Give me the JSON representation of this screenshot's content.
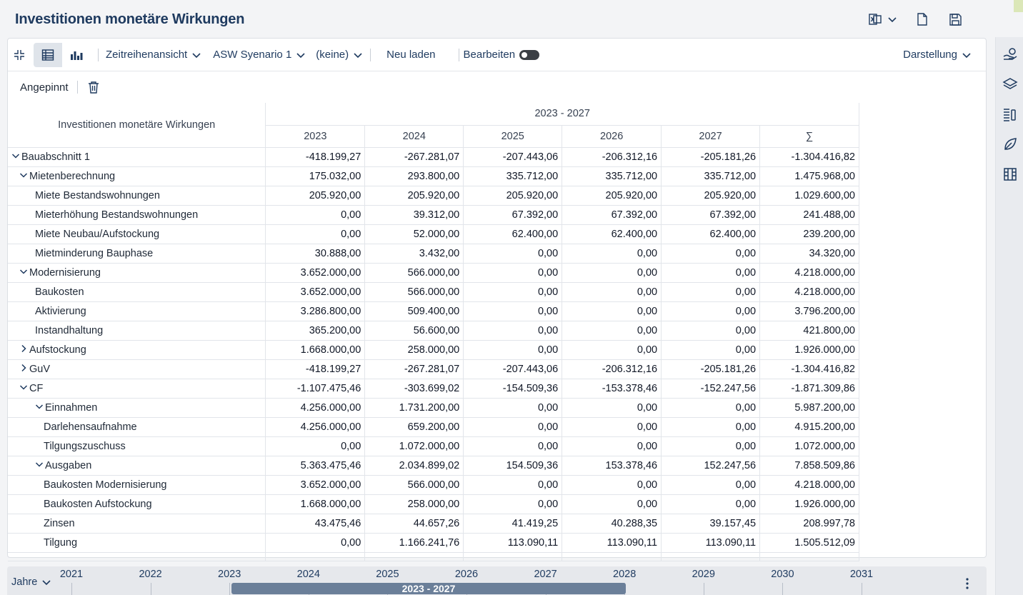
{
  "page": {
    "title": "Investitionen monetäre Wirkungen"
  },
  "toolbar": {
    "view_dropdown": "Zeitreihenansicht",
    "scenario_dropdown": "ASW Syenario 1",
    "filter_dropdown": "(keine)",
    "reload_label": "Neu laden",
    "edit_label": "Bearbeiten",
    "edit_enabled": false,
    "display_dropdown": "Darstellung"
  },
  "subbar": {
    "pinned_label": "Angepinnt"
  },
  "icons": {
    "collapse": "collapse-arrows-icon",
    "table_view": "table-icon",
    "chart_view": "bar-chart-icon",
    "excel_export": "excel-icon",
    "document": "document-icon",
    "save": "save-icon",
    "trash": "trash-icon",
    "rail": [
      "hand-coin-icon",
      "layers-icon",
      "list-bars-icon",
      "leaf-icon",
      "book-icon"
    ]
  },
  "grid": {
    "corner_header": "Investitionen monetäre Wirkungen",
    "period_header": "2023 - 2027",
    "columns": [
      "2023",
      "2024",
      "2025",
      "2026",
      "2027",
      "∑"
    ],
    "rows": [
      {
        "label": "Bauabschnitt 1",
        "level": 0,
        "toggle": "expanded",
        "values": [
          "-418.199,27",
          "-267.281,07",
          "-207.443,06",
          "-206.312,16",
          "-205.181,26",
          "-1.304.416,82"
        ]
      },
      {
        "label": "Mietenberechnung",
        "level": 1,
        "toggle": "expanded",
        "values": [
          "175.032,00",
          "293.800,00",
          "335.712,00",
          "335.712,00",
          "335.712,00",
          "1.475.968,00"
        ]
      },
      {
        "label": "Miete Bestandswohnungen",
        "level": 2,
        "toggle": "none",
        "values": [
          "205.920,00",
          "205.920,00",
          "205.920,00",
          "205.920,00",
          "205.920,00",
          "1.029.600,00"
        ]
      },
      {
        "label": "Mieterhöhung Bestandswohnungen",
        "level": 2,
        "toggle": "none",
        "values": [
          "0,00",
          "39.312,00",
          "67.392,00",
          "67.392,00",
          "67.392,00",
          "241.488,00"
        ]
      },
      {
        "label": "Miete Neubau/Aufstockung",
        "level": 2,
        "toggle": "none",
        "values": [
          "0,00",
          "52.000,00",
          "62.400,00",
          "62.400,00",
          "62.400,00",
          "239.200,00"
        ]
      },
      {
        "label": "Mietminderung Bauphase",
        "level": 2,
        "toggle": "none",
        "values": [
          "30.888,00",
          "3.432,00",
          "0,00",
          "0,00",
          "0,00",
          "34.320,00"
        ]
      },
      {
        "label": "Modernisierung",
        "level": 1,
        "toggle": "expanded",
        "values": [
          "3.652.000,00",
          "566.000,00",
          "0,00",
          "0,00",
          "0,00",
          "4.218.000,00"
        ]
      },
      {
        "label": "Baukosten",
        "level": 2,
        "toggle": "none",
        "values": [
          "3.652.000,00",
          "566.000,00",
          "0,00",
          "0,00",
          "0,00",
          "4.218.000,00"
        ]
      },
      {
        "label": "Aktivierung",
        "level": 2,
        "toggle": "none",
        "values": [
          "3.286.800,00",
          "509.400,00",
          "0,00",
          "0,00",
          "0,00",
          "3.796.200,00"
        ]
      },
      {
        "label": "Instandhaltung",
        "level": 2,
        "toggle": "none",
        "values": [
          "365.200,00",
          "56.600,00",
          "0,00",
          "0,00",
          "0,00",
          "421.800,00"
        ]
      },
      {
        "label": "Aufstockung",
        "level": 1,
        "toggle": "collapsed",
        "values": [
          "1.668.000,00",
          "258.000,00",
          "0,00",
          "0,00",
          "0,00",
          "1.926.000,00"
        ]
      },
      {
        "label": "GuV",
        "level": 1,
        "toggle": "collapsed",
        "values": [
          "-418.199,27",
          "-267.281,07",
          "-207.443,06",
          "-206.312,16",
          "-205.181,26",
          "-1.304.416,82"
        ]
      },
      {
        "label": "CF",
        "level": 1,
        "toggle": "expanded",
        "values": [
          "-1.107.475,46",
          "-303.699,02",
          "-154.509,36",
          "-153.378,46",
          "-152.247,56",
          "-1.871.309,86"
        ]
      },
      {
        "label": "Einnahmen",
        "level": 2,
        "toggle": "expanded",
        "values": [
          "4.256.000,00",
          "1.731.200,00",
          "0,00",
          "0,00",
          "0,00",
          "5.987.200,00"
        ]
      },
      {
        "label": "Darlehensaufnahme",
        "level": 3,
        "toggle": "none",
        "values": [
          "4.256.000,00",
          "659.200,00",
          "0,00",
          "0,00",
          "0,00",
          "4.915.200,00"
        ]
      },
      {
        "label": "Tilgungszuschuss",
        "level": 3,
        "toggle": "none",
        "values": [
          "0,00",
          "1.072.000,00",
          "0,00",
          "0,00",
          "0,00",
          "1.072.000,00"
        ]
      },
      {
        "label": "Ausgaben",
        "level": 2,
        "toggle": "expanded",
        "values": [
          "5.363.475,46",
          "2.034.899,02",
          "154.509,36",
          "153.378,46",
          "152.247,56",
          "7.858.509,86"
        ]
      },
      {
        "label": "Baukosten Modernisierung",
        "level": 3,
        "toggle": "none",
        "values": [
          "3.652.000,00",
          "566.000,00",
          "0,00",
          "0,00",
          "0,00",
          "4.218.000,00"
        ]
      },
      {
        "label": "Baukosten Aufstockung",
        "level": 3,
        "toggle": "none",
        "values": [
          "1.668.000,00",
          "258.000,00",
          "0,00",
          "0,00",
          "0,00",
          "1.926.000,00"
        ]
      },
      {
        "label": "Zinsen",
        "level": 3,
        "toggle": "none",
        "values": [
          "43.475,46",
          "44.657,26",
          "41.419,25",
          "40.288,35",
          "39.157,45",
          "208.997,78"
        ]
      },
      {
        "label": "Tilgung",
        "level": 3,
        "toggle": "none",
        "values": [
          "0,00",
          "1.166.241,76",
          "113.090,11",
          "113.090,11",
          "113.090,11",
          "1.505.512,09"
        ]
      }
    ]
  },
  "timeline": {
    "unit_dropdown": "Jahre",
    "years": [
      "2021",
      "2022",
      "2023",
      "2024",
      "2025",
      "2026",
      "2027",
      "2028",
      "2029",
      "2030",
      "2031"
    ],
    "selected_range": "2023 - 2027"
  }
}
